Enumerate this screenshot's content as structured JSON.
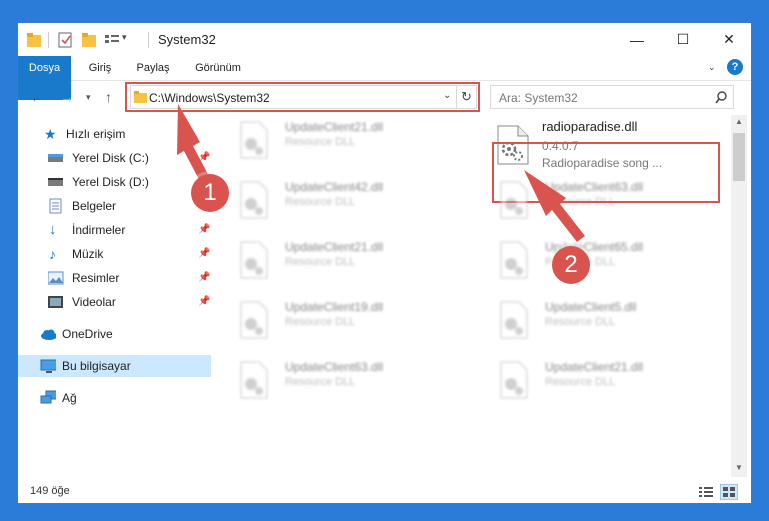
{
  "window": {
    "title": "System32",
    "controls": {
      "minimize": "—",
      "maximize": "☐",
      "close": "✕"
    }
  },
  "ribbon": {
    "tabs": [
      "Dosya",
      "Giriş",
      "Paylaş",
      "Görünüm"
    ],
    "help": "?"
  },
  "address": {
    "path": "C:\\Windows\\System32"
  },
  "search": {
    "placeholder": "Ara: System32"
  },
  "sidebar": {
    "items": [
      {
        "label": "Hızlı erişim",
        "icon": "star-icon"
      },
      {
        "label": "Yerel Disk (C:)",
        "icon": "drive-icon"
      },
      {
        "label": "Yerel Disk (D:)",
        "icon": "drive-icon"
      },
      {
        "label": "Belgeler",
        "icon": "documents-icon"
      },
      {
        "label": "İndirmeler",
        "icon": "download-icon"
      },
      {
        "label": "Müzik",
        "icon": "music-icon"
      },
      {
        "label": "Resimler",
        "icon": "pictures-icon"
      },
      {
        "label": "Videolar",
        "icon": "videos-icon"
      },
      {
        "label": "OneDrive",
        "icon": "cloud-icon"
      },
      {
        "label": "Bu bilgisayar",
        "icon": "computer-icon"
      },
      {
        "label": "Ağ",
        "icon": "network-icon"
      }
    ]
  },
  "files": {
    "left": [
      {
        "name": "UpdateClient21.dll",
        "desc": "Resource DLL"
      },
      {
        "name": "UpdateClient42.dll",
        "desc": "Resource DLL"
      },
      {
        "name": "UpdateClient21.dll",
        "desc": "Resource DLL"
      },
      {
        "name": "UpdateClient19.dll",
        "desc": "Resource DLL"
      },
      {
        "name": "UpdateClient63.dll",
        "desc": "Resource DLL"
      }
    ],
    "right": [
      {
        "name": "radioparadise.dll",
        "version": "0.4.0.7",
        "desc": "Radioparadise song ..."
      },
      {
        "name": "UpdateClient63.dll",
        "desc": "Resource DLL"
      },
      {
        "name": "UpdateClient65.dll",
        "desc": "Resource DLL"
      },
      {
        "name": "UpdateClient5.dll",
        "desc": "Resource DLL"
      },
      {
        "name": "UpdateClient21.dll",
        "desc": "Resource DLL"
      }
    ]
  },
  "status": {
    "count": "149 öğe"
  },
  "annotations": {
    "step1": "1",
    "step2": "2"
  },
  "colors": {
    "accent": "#1979ca",
    "highlight": "#d9534f",
    "selected": "#cce8ff"
  }
}
